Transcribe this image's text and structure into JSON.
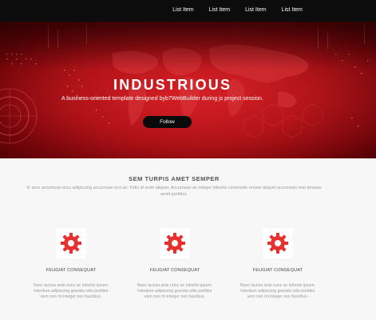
{
  "nav": {
    "items": [
      "List Item",
      "List Item",
      "List Item",
      "List Item"
    ]
  },
  "hero": {
    "title": "INDUSTRIOUS",
    "subtitle": "A business-oriented template designed byb7WebBuilder during js project session.",
    "button_label": "Follow"
  },
  "intro": {
    "title": "SEM TURPIS AMET SEMPER",
    "text": "In arcu accumsan arcu adipiscing accumsan orci ac. Felis id enim aliquet. Accumsan ac integer lobortis commodo ornare aliquet accumsan erat tempus amet porttitor."
  },
  "features": [
    {
      "icon": "gear-icon",
      "title": "FEUGIAT CONSEQUAT",
      "text": "Nunc lacinia ante nunc ac lobortis ipsum. Interdum adipiscing gravida odio porttitor sem non mi integer non faucibus."
    },
    {
      "icon": "gear-icon",
      "title": "FEUGIAT CONSEQUAT",
      "text": "Nunc lacinia ante nunc ac lobortis ipsum. Interdum adipiscing gravida odio porttitor sem non mi integer non faucibus."
    },
    {
      "icon": "gear-icon",
      "title": "FEUGIAT CONSEQUAT",
      "text": "Nunc lacinia ante nunc ac lobortis ipsum. Interdum adipiscing gravida odio porttitor sem non mi integer non faucibus."
    }
  ],
  "colors": {
    "accent": "#e0201f",
    "hero_red": "#b30f16",
    "nav_bg": "#0c0c0c"
  }
}
